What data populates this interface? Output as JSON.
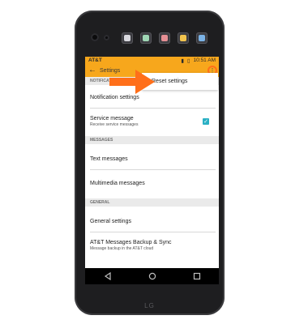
{
  "device": {
    "brand": "LG"
  },
  "status_bar": {
    "carrier": "AT&T",
    "time": "10:51 AM"
  },
  "app_bar": {
    "title": "Settings",
    "back_icon": "arrow-left-icon",
    "overflow_icon": "more-vert-icon"
  },
  "menu": {
    "items": [
      {
        "label": "Reset settings"
      }
    ]
  },
  "sections": [
    {
      "header": "NOTIFICATIO",
      "items": [
        {
          "label": "Notification settings"
        },
        {
          "label": "Service message",
          "sub": "Receive service messages",
          "checked": true
        }
      ]
    },
    {
      "header": "MESSAGES",
      "items": [
        {
          "label": "Text messages"
        },
        {
          "label": "Multimedia messages"
        }
      ]
    },
    {
      "header": "GENERAL",
      "items": [
        {
          "label": "General settings"
        },
        {
          "label": "AT&T Messages Backup & Sync",
          "sub": "Message backup in the AT&T cloud"
        }
      ]
    }
  ],
  "colors": {
    "accent": "#f7a71c",
    "arrow": "#ff6f1a",
    "checkbox": "#2ab0c4"
  }
}
